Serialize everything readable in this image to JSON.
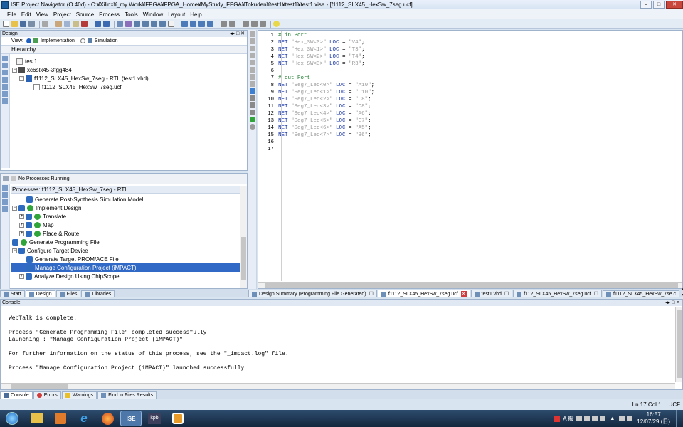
{
  "window": {
    "title": "ISE Project Navigator (O.40d) - C:¥Xilinx¥_my Work¥FPGA¥FPGA_Home¥MyStudy_FPGA¥Tokuden¥test1¥test1¥test1.xise - [f1112_SLX45_HexSw_7seg.ucf]"
  },
  "menu": [
    "File",
    "Edit",
    "View",
    "Project",
    "Source",
    "Process",
    "Tools",
    "Window",
    "Layout",
    "Help"
  ],
  "design_panel": {
    "header": "Design",
    "view_label": "View:",
    "view_implementation": "Implementation",
    "view_simulation": "Simulation",
    "hierarchy_label": "Hierarchy",
    "tree": [
      {
        "label": "test1",
        "level": 0
      },
      {
        "label": "xc6slx45-3fgg484",
        "level": 0
      },
      {
        "label": "f1112_SLX45_HexSw_7seg - RTL (test1.vhd)",
        "level": 1
      },
      {
        "label": "f1112_SLX45_HexSw_7seg.ucf",
        "level": 2
      }
    ]
  },
  "processes_panel": {
    "status": "No Processes Running",
    "header": "Processes: f1112_SLX45_HexSw_7seg - RTL",
    "items": [
      {
        "label": "Generate Post-Synthesis Simulation Model",
        "level": 2,
        "selected": false
      },
      {
        "label": "Implement Design",
        "level": 0,
        "selected": false
      },
      {
        "label": "Translate",
        "level": 1,
        "selected": false
      },
      {
        "label": "Map",
        "level": 1,
        "selected": false
      },
      {
        "label": "Place & Route",
        "level": 1,
        "selected": false
      },
      {
        "label": "Generate Programming File",
        "level": 0,
        "selected": false
      },
      {
        "label": "Configure Target Device",
        "level": 0,
        "selected": false
      },
      {
        "label": "Generate Target PROM/ACE File",
        "level": 2,
        "selected": false
      },
      {
        "label": "Manage Configuration Project (iMPACT)",
        "level": 2,
        "selected": true
      },
      {
        "label": "Analyze Design Using ChipScope",
        "level": 1,
        "selected": false
      }
    ]
  },
  "left_tabs": [
    "Start",
    "Design",
    "Files",
    "Libraries"
  ],
  "editor": {
    "lines": [
      {
        "n": "1",
        "parts": [
          {
            "t": "# in Port",
            "c": "cm"
          }
        ]
      },
      {
        "n": "2",
        "parts": [
          {
            "t": "NET ",
            "c": "kw"
          },
          {
            "t": "\"Hex_SW<0>\"",
            "c": "str"
          },
          {
            "t": " LOC",
            "c": "kw"
          },
          {
            "t": " = ",
            "c": ""
          },
          {
            "t": "\"V4\"",
            "c": "str"
          },
          {
            "t": ";",
            "c": ""
          }
        ]
      },
      {
        "n": "3",
        "parts": [
          {
            "t": "NET ",
            "c": "kw"
          },
          {
            "t": "\"Hex_SW<1>\"",
            "c": "str"
          },
          {
            "t": " LOC",
            "c": "kw"
          },
          {
            "t": " = ",
            "c": ""
          },
          {
            "t": "\"T3\"",
            "c": "str"
          },
          {
            "t": ";",
            "c": ""
          }
        ]
      },
      {
        "n": "4",
        "parts": [
          {
            "t": "NET ",
            "c": "kw"
          },
          {
            "t": "\"Hex_SW<2>\"",
            "c": "str"
          },
          {
            "t": " LOC",
            "c": "kw"
          },
          {
            "t": " = ",
            "c": ""
          },
          {
            "t": "\"T4\"",
            "c": "str"
          },
          {
            "t": ";",
            "c": ""
          }
        ]
      },
      {
        "n": "5",
        "parts": [
          {
            "t": "NET ",
            "c": "kw"
          },
          {
            "t": "\"Hex_SW<3>\"",
            "c": "str"
          },
          {
            "t": " LOC",
            "c": "kw"
          },
          {
            "t": " = ",
            "c": ""
          },
          {
            "t": "\"R3\"",
            "c": "str"
          },
          {
            "t": ";",
            "c": ""
          }
        ]
      },
      {
        "n": "6",
        "parts": []
      },
      {
        "n": "7",
        "parts": [
          {
            "t": "# out Port",
            "c": "cm"
          }
        ]
      },
      {
        "n": "8",
        "parts": [
          {
            "t": "NET ",
            "c": "kw"
          },
          {
            "t": "\"Seg7_Led<0>\"",
            "c": "str"
          },
          {
            "t": " LOC",
            "c": "kw"
          },
          {
            "t": " = ",
            "c": ""
          },
          {
            "t": "\"A10\"",
            "c": "str"
          },
          {
            "t": ";",
            "c": ""
          }
        ]
      },
      {
        "n": "9",
        "parts": [
          {
            "t": "NET ",
            "c": "kw"
          },
          {
            "t": "\"Seg7_Led<1>\"",
            "c": "str"
          },
          {
            "t": " LOC",
            "c": "kw"
          },
          {
            "t": " = ",
            "c": ""
          },
          {
            "t": "\"C10\"",
            "c": "str"
          },
          {
            "t": ";",
            "c": ""
          }
        ]
      },
      {
        "n": "10",
        "parts": [
          {
            "t": "NET ",
            "c": "kw"
          },
          {
            "t": "\"Seg7_Led<2>\"",
            "c": "str"
          },
          {
            "t": " LOC",
            "c": "kw"
          },
          {
            "t": " = ",
            "c": ""
          },
          {
            "t": "\"C8\"",
            "c": "str"
          },
          {
            "t": ";",
            "c": ""
          }
        ]
      },
      {
        "n": "11",
        "parts": [
          {
            "t": "NET ",
            "c": "kw"
          },
          {
            "t": "\"Seg7_Led<3>\"",
            "c": "str"
          },
          {
            "t": " LOC",
            "c": "kw"
          },
          {
            "t": " = ",
            "c": ""
          },
          {
            "t": "\"D8\"",
            "c": "str"
          },
          {
            "t": ";",
            "c": ""
          }
        ]
      },
      {
        "n": "12",
        "parts": [
          {
            "t": "NET ",
            "c": "kw"
          },
          {
            "t": "\"Seg7_Led<4>\"",
            "c": "str"
          },
          {
            "t": " LOC",
            "c": "kw"
          },
          {
            "t": " = ",
            "c": ""
          },
          {
            "t": "\"A6\"",
            "c": "str"
          },
          {
            "t": ";",
            "c": ""
          }
        ]
      },
      {
        "n": "13",
        "parts": [
          {
            "t": "NET ",
            "c": "kw"
          },
          {
            "t": "\"Seg7_Led<5>\"",
            "c": "str"
          },
          {
            "t": " LOC",
            "c": "kw"
          },
          {
            "t": " = ",
            "c": ""
          },
          {
            "t": "\"C7\"",
            "c": "str"
          },
          {
            "t": ";",
            "c": ""
          }
        ]
      },
      {
        "n": "14",
        "parts": [
          {
            "t": "NET ",
            "c": "kw"
          },
          {
            "t": "\"Seg7_Led<6>\"",
            "c": "str"
          },
          {
            "t": " LOC",
            "c": "kw"
          },
          {
            "t": " = ",
            "c": ""
          },
          {
            "t": "\"A5\"",
            "c": "str"
          },
          {
            "t": ";",
            "c": ""
          }
        ]
      },
      {
        "n": "15",
        "parts": [
          {
            "t": "NET ",
            "c": "kw"
          },
          {
            "t": "\"Seg7_Led<7>\"",
            "c": "str"
          },
          {
            "t": " LOC",
            "c": "kw"
          },
          {
            "t": " = ",
            "c": ""
          },
          {
            "t": "\"B6\"",
            "c": "str"
          },
          {
            "t": ";",
            "c": ""
          }
        ]
      },
      {
        "n": "16",
        "parts": []
      },
      {
        "n": "17",
        "parts": []
      }
    ]
  },
  "editor_tabs": [
    {
      "label": "Design Summary (Programming File Generated)",
      "active": false
    },
    {
      "label": "f1112_SLX45_HexSw_7seg.ucf",
      "active": true
    },
    {
      "label": "test1.vhd",
      "active": false
    },
    {
      "label": "f112_SLX45_HexSw_7seg.ucf",
      "active": false
    },
    {
      "label": "f1112_SLX45_HexSw_7se c",
      "active": false
    }
  ],
  "console": {
    "header": "Console",
    "text": "WebTalk is complete.\n\nProcess \"Generate Programming File\" completed successfully\nLaunching : \"Manage Configuration Project (iMPACT)\"\n\nFor further information on the status of this process, see the \"_impact.log\" file.\n\nProcess \"Manage Configuration Project (iMPACT)\" launched successfully"
  },
  "bottom_tabs": [
    "Console",
    "Errors",
    "Warnings",
    "Find in Files Results"
  ],
  "statusbar": {
    "position": "Ln 17 Col 1",
    "filetype": "UCF"
  },
  "taskbar": {
    "time": "16:57",
    "date": "12/07/29 (日)",
    "ime": "A 般",
    "apps": [
      "ISE",
      "kpb"
    ]
  },
  "colors": {
    "selection": "#3169c6",
    "comment": "#1a7a2a",
    "keyword": "#1533a6",
    "string": "#9a9a9a",
    "ok": "#2fa53a"
  }
}
